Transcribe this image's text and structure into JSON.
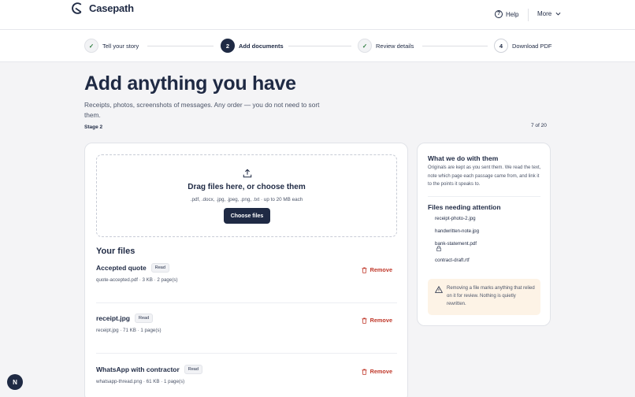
{
  "brand": {
    "name": "Casepath"
  },
  "header": {
    "help_label": "Help",
    "more_label": "More"
  },
  "steps": [
    {
      "number": "1",
      "label": "Tell your story",
      "status": "done"
    },
    {
      "number": "2",
      "label": "Add documents",
      "status": "active"
    },
    {
      "number": "3",
      "label": "Review details",
      "status": "done"
    },
    {
      "number": "4",
      "label": "Download PDF",
      "status": "todo"
    }
  ],
  "hero": {
    "title": "Add anything you have",
    "subtitle": "Receipts, photos, screenshots of messages. Any order — you do not need to sort them.",
    "stage": "Stage 2",
    "count": "7 of 20"
  },
  "upload": {
    "title": "Drag files here, or choose them",
    "hint": ".pdf, .docx, .jpg, .jpeg, .png, .txt · up to 20 MB each",
    "button": "Choose files"
  },
  "files": {
    "title": "Your files",
    "remove_label": "Remove",
    "items": [
      {
        "name": "Accepted quote",
        "status": "Read",
        "meta": "quote-accepted.pdf · 3 KB · 2 page(s)"
      },
      {
        "name": "receipt.jpg",
        "status": "Read",
        "meta": "receipt.jpg · 71 KB · 1 page(s)"
      },
      {
        "name": "WhatsApp with contractor",
        "status": "Read",
        "meta": "whatsapp-thread.png · 61 KB · 1 page(s)"
      }
    ]
  },
  "sidebar": {
    "title": "What we do with them",
    "body": "Originals are kept as you sent them. We read the text, note which page each passage came from, and link it to the points it speaks to.",
    "needs_title": "Files needing attention",
    "needs": [
      "receipt-photo-2.jpg",
      "handwritten-note.jpg",
      "bank-statement.pdf",
      "contract-draft.rtf"
    ],
    "warning": "Removing a file marks anything that relied on it for review. Nothing is quietly rewritten."
  },
  "fab_label": "N",
  "colors": {
    "primary": "#1f2a44",
    "danger": "#c0392b",
    "success": "#2a7a3b",
    "warning_bg": "#fdf3e6"
  }
}
